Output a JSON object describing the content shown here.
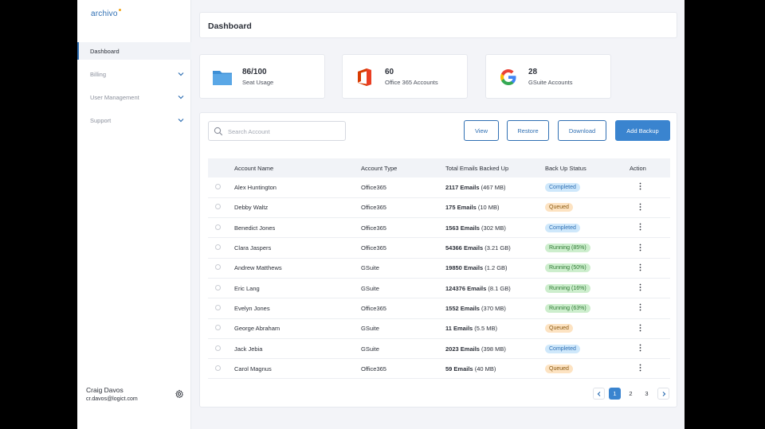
{
  "brand": {
    "name": "archivo",
    "accent": "#2f6fb3",
    "dot_color": "#f2a51a"
  },
  "sidebar": {
    "items": [
      {
        "label": "Dashboard",
        "active": true
      },
      {
        "label": "Billing",
        "active": false
      },
      {
        "label": "User Management",
        "active": false
      },
      {
        "label": "Support",
        "active": false
      }
    ],
    "user": {
      "name": "Craig Davos",
      "email": "cr.davos@logict.com"
    }
  },
  "header": {
    "title": "Dashboard"
  },
  "stats": [
    {
      "value": "86/100",
      "label": "Seat Usage",
      "icon": "folder-icon"
    },
    {
      "value": "60",
      "label": "Office 365 Accounts",
      "icon": "office365-icon"
    },
    {
      "value": "28",
      "label": "GSuite Accounts",
      "icon": "google-icon"
    }
  ],
  "toolbar": {
    "search_placeholder": "Search Account",
    "view_label": "View",
    "restore_label": "Restore",
    "download_label": "Download",
    "add_backup_label": "Add Backup"
  },
  "table": {
    "columns": [
      "Account Name",
      "Account Type",
      "Total Emails Backed Up",
      "Back Up Status",
      "Action"
    ],
    "rows": [
      {
        "name": "Alex Huntington",
        "type": "Office365",
        "emails": "2117 Emails",
        "size": "(467 MB)",
        "status": "Completed"
      },
      {
        "name": "Debby Waltz",
        "type": "Office365",
        "emails": "175 Emails",
        "size": "(10 MB)",
        "status": "Queued"
      },
      {
        "name": "Benedict Jones",
        "type": "Office365",
        "emails": "1563 Emails",
        "size": "(302 MB)",
        "status": "Completed"
      },
      {
        "name": "Clara Jaspers",
        "type": "Office365",
        "emails": "54366 Emails",
        "size": "(3.21 GB)",
        "status": "Running (85%)"
      },
      {
        "name": "Andrew Matthews",
        "type": "GSuite",
        "emails": "19850 Emails",
        "size": "(1.2 GB)",
        "status": "Running (50%)"
      },
      {
        "name": "Eric Lang",
        "type": "GSuite",
        "emails": "124376 Emails",
        "size": "(8.1 GB)",
        "status": "Running (16%)"
      },
      {
        "name": "Evelyn Jones",
        "type": "Office365",
        "emails": "1552 Emails",
        "size": "(370 MB)",
        "status": "Running (63%)"
      },
      {
        "name": "George Abraham",
        "type": "GSuite",
        "emails": "11 Emails",
        "size": "(5.5 MB)",
        "status": "Queued"
      },
      {
        "name": "Jack Jebia",
        "type": "GSuite",
        "emails": "2023 Emails",
        "size": "(398 MB)",
        "status": "Completed"
      },
      {
        "name": "Carol Magnus",
        "type": "Office365",
        "emails": "59 Emails",
        "size": "(40 MB)",
        "status": "Queued"
      }
    ]
  },
  "status_colors": {
    "Completed": {
      "bg": "#cfe8fb",
      "fg": "#2f6fb3"
    },
    "Queued": {
      "bg": "#fde3c2",
      "fg": "#8a5a12"
    },
    "Running": {
      "bg": "#cdeecd",
      "fg": "#2f7a34"
    }
  },
  "pagination": {
    "pages": [
      "1",
      "2",
      "3"
    ],
    "current": "1"
  }
}
